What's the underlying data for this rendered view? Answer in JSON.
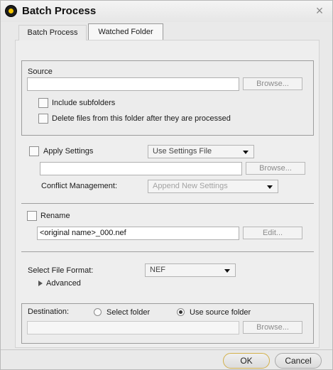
{
  "window": {
    "title": "Batch Process",
    "icon": "nikon-app-icon",
    "close_icon": "close-icon"
  },
  "tabs": [
    {
      "label": "Batch Process",
      "active": true
    },
    {
      "label": "Watched Folder",
      "active": false
    }
  ],
  "source": {
    "label": "Source",
    "path_value": "",
    "browse_label": "Browse...",
    "include_subfolders_label": "Include subfolders",
    "include_subfolders_checked": false,
    "delete_files_label": "Delete files from this folder after they are processed",
    "delete_files_checked": false
  },
  "settings": {
    "apply_label": "Apply Settings",
    "apply_checked": false,
    "settings_mode": "Use Settings File",
    "settings_file_value": "",
    "browse_label": "Browse...",
    "conflict_label": "Conflict Management:",
    "conflict_value": "Append New Settings"
  },
  "rename": {
    "label": "Rename",
    "checked": false,
    "pattern_value": "<original name>_000.nef",
    "edit_label": "Edit..."
  },
  "format": {
    "label": "Select File Format:",
    "value": "NEF",
    "advanced_label": "Advanced"
  },
  "destination": {
    "label": "Destination:",
    "select_folder_label": "Select folder",
    "use_source_label": "Use source folder",
    "selected": "use_source",
    "path_value": "",
    "browse_label": "Browse..."
  },
  "footer": {
    "ok_label": "OK",
    "cancel_label": "Cancel"
  },
  "colors": {
    "dialog_bg": "#e9e9e9",
    "accent_border": "#d2b04a",
    "disabled_text": "#8b8b8b"
  }
}
